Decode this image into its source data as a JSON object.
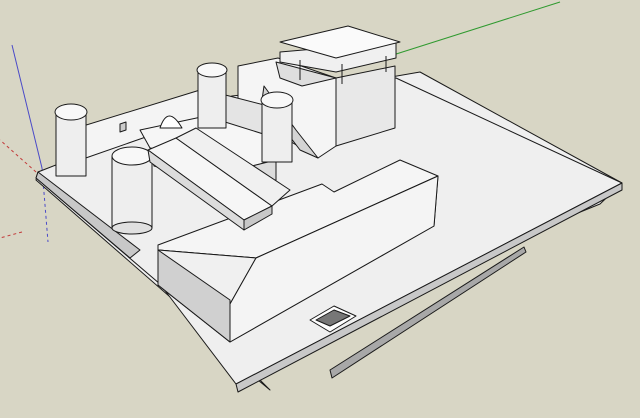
{
  "viewport": {
    "background": "#d8d6c5"
  },
  "axes": {
    "red_color": "#c23a3a",
    "green_color": "#2f9a2f",
    "blue_color": "#4a4ac8"
  },
  "model": {
    "face_light": "#f2f2f2",
    "face_mid": "#dcdcdc",
    "face_dark": "#bdbdbd",
    "edge_color": "#1a1a1a"
  }
}
